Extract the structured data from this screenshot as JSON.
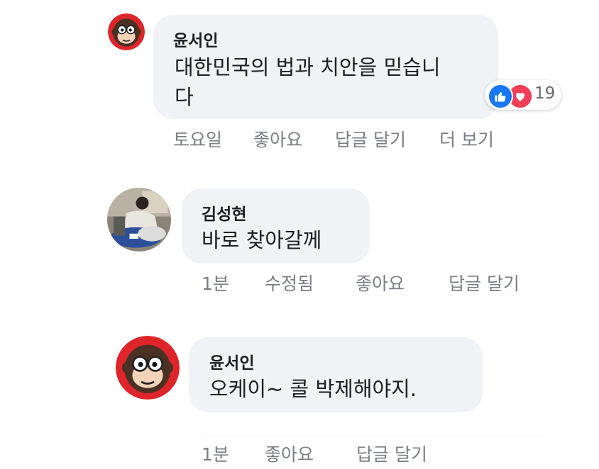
{
  "comments": [
    {
      "author": "윤서인",
      "text_lines": [
        "대한민국의 법과 치안을 믿습니",
        "다"
      ],
      "reactions": {
        "count": "19",
        "types": [
          "like-icon",
          "love-icon"
        ]
      },
      "actions": {
        "time": "토요일",
        "like": "좋아요",
        "reply": "답글 달기",
        "more": "더 보기"
      }
    },
    {
      "author": "김성현",
      "text_lines": [
        "바로 찾아갈께"
      ],
      "actions": {
        "time": "1분",
        "edited": "수정됨",
        "like": "좋아요",
        "reply": "답글 달기"
      }
    },
    {
      "author": "윤서인",
      "text_lines": [
        "오케이~ 콜 박제해야지."
      ],
      "actions": {
        "time": "1분",
        "like": "좋아요",
        "reply": "답글 달기"
      }
    }
  ],
  "colors": {
    "bubble": "#f0f2f5",
    "meta_text": "#7a7d82",
    "like_blue": "#1877f2",
    "love_red": "#f33e58"
  }
}
